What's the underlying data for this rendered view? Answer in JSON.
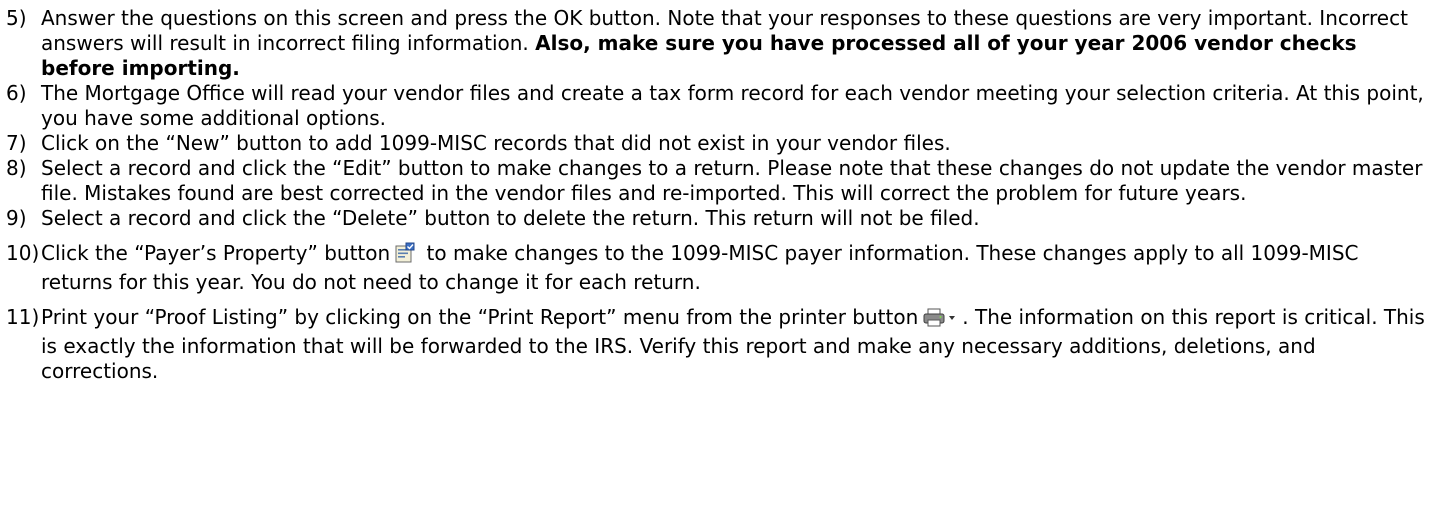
{
  "steps": [
    {
      "num": "5)",
      "text": "Answer the questions on this screen and press the OK button. Note that your responses to these questions are very important. Incorrect answers will result in incorrect filing information. ",
      "bold": "Also, make sure you have processed all of your year 2006 vendor checks before importing."
    },
    {
      "num": "6)",
      "text": "The Mortgage Office will read your vendor files and create a tax form record for each vendor meeting your selection criteria. At this point, you have some additional options."
    },
    {
      "num": "7)",
      "text": "Click on the “New” button to add 1099-MISC records that did not exist in your vendor files."
    },
    {
      "num": "8)",
      "text": "Select a record and click the “Edit” button to make changes to a return. Please note that these changes do not update the vendor master file. Mistakes found are best corrected in the vendor files and re-imported. This will correct the problem for future years."
    },
    {
      "num": "9)",
      "text": "Select a record and click the “Delete” button to delete the return. This return will not be filed."
    },
    {
      "num": "10)",
      "text_before": "Click the “Payer’s Property” button",
      "icon": "payer-property-icon",
      "text_after": " to make changes to the 1099-MISC payer information. These changes apply to all 1099-MISC returns for this year. You do not need to change it for each return."
    },
    {
      "num": "11)",
      "text_before": "Print your “Proof Listing” by clicking on the “Print Report” menu from the printer button",
      "icon": "printer-dropdown-icon",
      "text_after": ". The information on this report is critical. This is exactly the information that will be forwarded to the IRS. Verify this report and make any necessary additions, deletions, and corrections."
    }
  ]
}
